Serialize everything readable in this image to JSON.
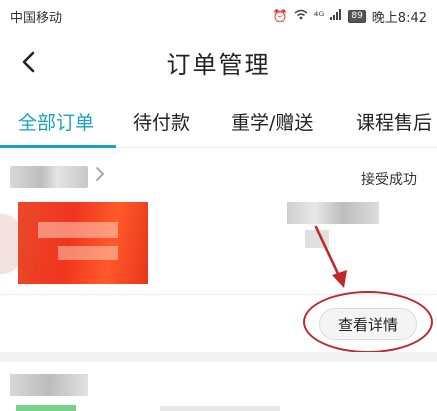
{
  "status_bar": {
    "carrier": "中国移动",
    "signal": "⁴ᴳ",
    "battery": "89",
    "time": "晚上8:42"
  },
  "header": {
    "title": "订单管理"
  },
  "tabs": [
    {
      "label": "全部订单",
      "active": true
    },
    {
      "label": "待付款",
      "active": false
    },
    {
      "label": "重学/赠送",
      "active": false
    },
    {
      "label": "课程售后",
      "active": false
    }
  ],
  "order": {
    "status": "接受成功",
    "detail_button": "查看详情"
  },
  "colors": {
    "accent": "#1aa1c4",
    "annotation": "#c0282c",
    "thumbnail": "#f2341e"
  }
}
